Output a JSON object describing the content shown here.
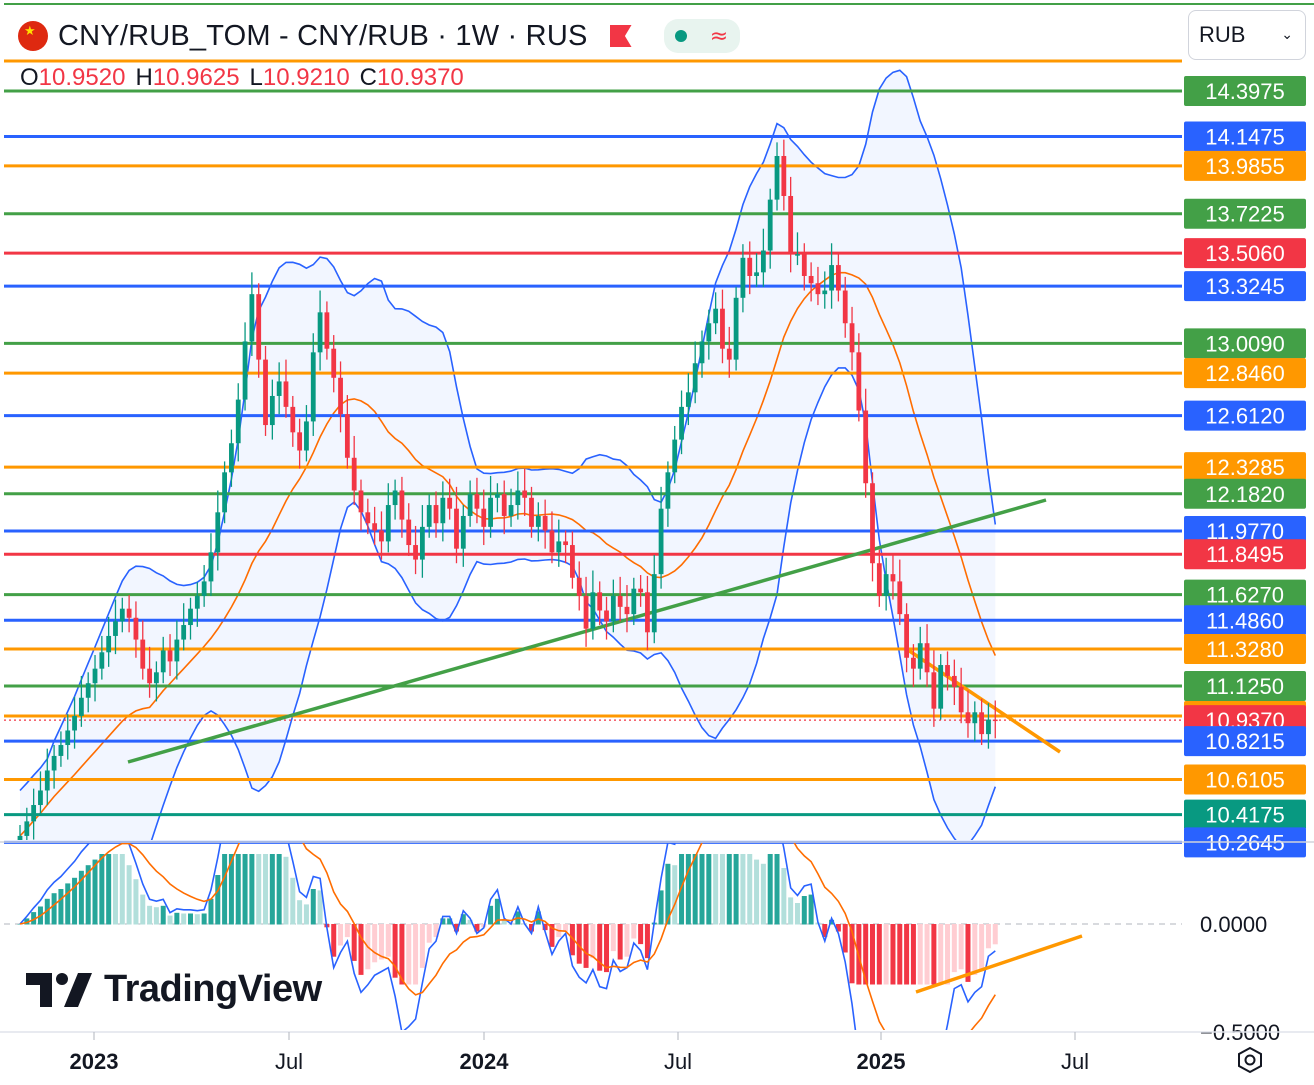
{
  "header": {
    "title": "CNY/RUB_TOM - CNY/RUB · 1W · RUS",
    "ohlc": {
      "o_label": "O",
      "o": "10.9520",
      "h_label": "H",
      "h": "10.9625",
      "l_label": "L",
      "l": "10.9210",
      "c_label": "C",
      "c": "10.9370"
    },
    "currency": "RUB",
    "currency_chevron": "⌄"
  },
  "branding": {
    "logo_text": "TradingView"
  },
  "icons": {
    "flag": "china-flag-icon",
    "alert": "red-flag-icon",
    "settings": "settings-hexagon-icon"
  },
  "colors": {
    "up": "#089981",
    "down": "#f23645",
    "blue": "#2962ff",
    "green": "#43a047",
    "orange": "#ff9800",
    "band": "#2962ff",
    "basis": "#ff6d00"
  },
  "chart_data": {
    "type": "candlestick",
    "timeframe": "1W",
    "x_axis_labels": [
      "2023",
      "Jul",
      "2024",
      "Jul",
      "2025",
      "Jul"
    ],
    "price_axis": {
      "ylim": [
        10.25,
        14.9
      ]
    },
    "horizontal_levels": [
      {
        "value": 14.3975,
        "color": "green"
      },
      {
        "value": 14.1475,
        "color": "blue"
      },
      {
        "value": 13.9855,
        "color": "orange"
      },
      {
        "value": 13.7225,
        "color": "green"
      },
      {
        "value": 13.506,
        "color": "red"
      },
      {
        "value": 13.3245,
        "color": "blue"
      },
      {
        "value": 13.009,
        "color": "green"
      },
      {
        "value": 12.846,
        "color": "orange"
      },
      {
        "value": 12.612,
        "color": "blue"
      },
      {
        "value": 12.3285,
        "color": "orange"
      },
      {
        "value": 12.182,
        "color": "green"
      },
      {
        "value": 11.977,
        "color": "blue"
      },
      {
        "value": 11.8495,
        "color": "red"
      },
      {
        "value": 11.627,
        "color": "green"
      },
      {
        "value": 11.486,
        "color": "blue"
      },
      {
        "value": 11.328,
        "color": "orange"
      },
      {
        "value": 11.125,
        "color": "green"
      },
      {
        "value": 10.96,
        "color": "orange"
      },
      {
        "value": 10.937,
        "color": "red"
      },
      {
        "value": 10.8215,
        "color": "blue"
      },
      {
        "value": 10.6105,
        "color": "orange"
      },
      {
        "value": 10.4175,
        "color": "teal"
      },
      {
        "value": 10.2645,
        "color": "blue"
      }
    ],
    "last_price": 10.937,
    "close_series": [
      10.3,
      10.38,
      10.47,
      10.55,
      10.66,
      10.74,
      10.8,
      10.88,
      10.96,
      11.06,
      11.14,
      11.22,
      11.31,
      11.4,
      11.48,
      11.55,
      11.5,
      11.38,
      11.22,
      11.14,
      11.2,
      11.32,
      11.26,
      11.38,
      11.46,
      11.55,
      11.62,
      11.7,
      11.86,
      12.08,
      12.3,
      12.46,
      12.7,
      13.02,
      13.28,
      12.92,
      12.56,
      12.72,
      12.8,
      12.66,
      12.52,
      12.42,
      12.58,
      12.96,
      13.18,
      12.98,
      12.82,
      12.62,
      12.38,
      12.2,
      12.08,
      12.02,
      11.98,
      11.92,
      12.12,
      12.2,
      12.04,
      11.9,
      11.82,
      12.0,
      12.12,
      12.02,
      12.16,
      12.1,
      11.88,
      12.06,
      12.18,
      12.1,
      12.0,
      12.16,
      12.18,
      12.06,
      12.12,
      12.2,
      12.16,
      12.0,
      12.06,
      11.98,
      11.86,
      11.92,
      11.9,
      11.72,
      11.62,
      11.44,
      11.64,
      11.54,
      11.48,
      11.62,
      11.56,
      11.52,
      11.66,
      11.64,
      11.42,
      11.74,
      12.1,
      12.3,
      12.48,
      12.66,
      12.74,
      12.9,
      13.02,
      13.12,
      13.2,
      12.98,
      12.92,
      13.26,
      13.48,
      13.38,
      13.4,
      13.52,
      13.8,
      14.04,
      13.82,
      13.5,
      13.5,
      13.38,
      13.34,
      13.28,
      13.3,
      13.44,
      13.3,
      13.12,
      12.96,
      12.64,
      12.24,
      11.8,
      11.62,
      11.74,
      11.7,
      11.52,
      11.28,
      11.22,
      11.36,
      11.2,
      11.0,
      11.24,
      11.18,
      11.12,
      10.98,
      10.92,
      10.98,
      10.86,
      10.94,
      10.937
    ],
    "bollinger": {
      "upper": "BB upper",
      "basis": "BB basis",
      "lower": "BB lower"
    },
    "trendlines": [
      {
        "color": "green",
        "from": [
          10.86,
          "2023-02"
        ],
        "to": [
          11.84,
          "2025-05"
        ]
      },
      {
        "color": "orange",
        "from": [
          11.1,
          "2025-03"
        ],
        "to": [
          10.75,
          "2025-06"
        ]
      }
    ],
    "oscillator": {
      "type": "MACD",
      "y_labels": [
        "0.0000",
        "−0.5000"
      ],
      "trendline": {
        "color": "orange"
      }
    }
  }
}
